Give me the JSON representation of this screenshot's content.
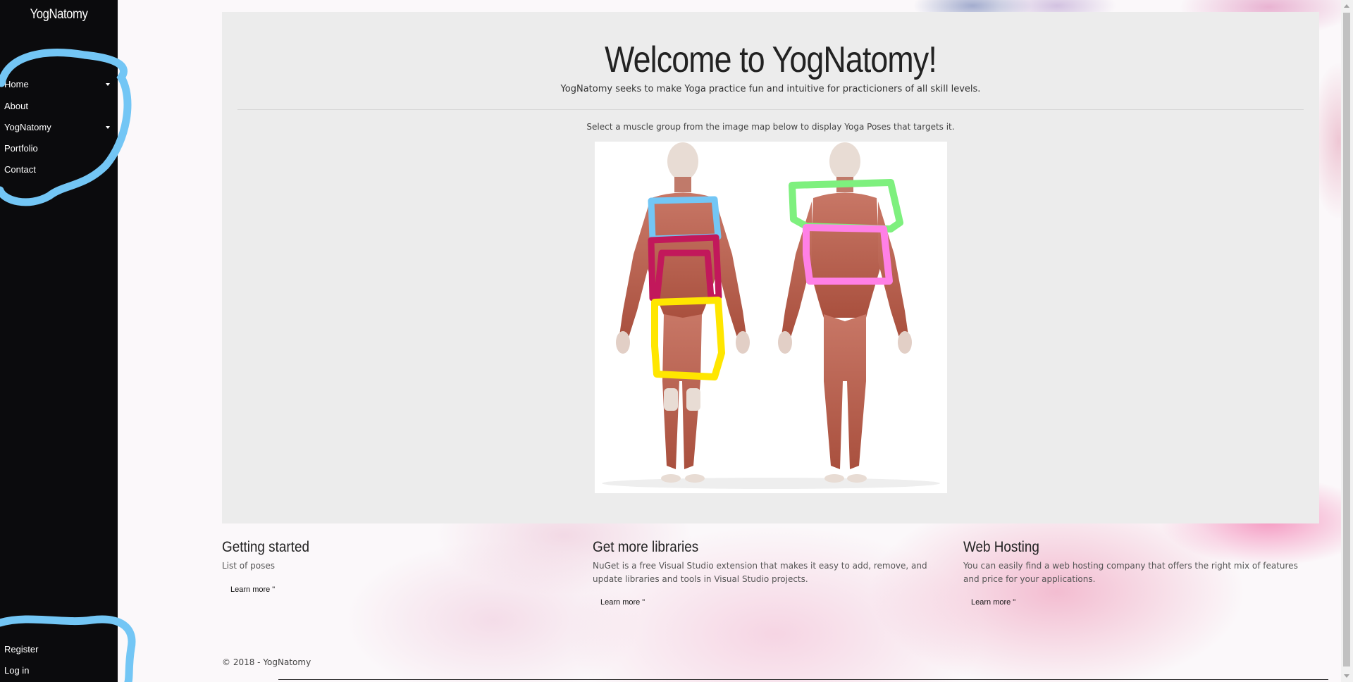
{
  "brand": "YogNatomy",
  "nav": {
    "items": [
      {
        "label": "Home",
        "has_caret": true
      },
      {
        "label": "About",
        "has_caret": false
      },
      {
        "label": "YogNatomy",
        "has_caret": true
      },
      {
        "label": "Portfolio",
        "has_caret": false
      },
      {
        "label": "Contact",
        "has_caret": false
      }
    ],
    "account": [
      {
        "label": "Register"
      },
      {
        "label": "Log in"
      }
    ]
  },
  "jumbotron": {
    "title": "Welcome to YogNatomy!",
    "subtitle": "YogNatomy seeks to make Yoga practice fun and intuitive for practicioners of all skill levels.",
    "instruction": "Select a muscle group from the image map below to display Yoga Poses that targets it."
  },
  "image_map": {
    "regions": [
      {
        "name": "chest",
        "color": "#73c6f5"
      },
      {
        "name": "abdomen",
        "color": "#c2185b"
      },
      {
        "name": "thighs",
        "color": "#ffe600"
      },
      {
        "name": "upper-back",
        "color": "#7ef07e"
      },
      {
        "name": "lower-back",
        "color": "#ff80e6"
      }
    ]
  },
  "annotations": {
    "color": "#73c6f5"
  },
  "columns": [
    {
      "title": "Getting started",
      "text": "List of poses",
      "button": "Learn more \""
    },
    {
      "title": "Get more libraries",
      "text": "NuGet is a free Visual Studio extension that makes it easy to add, remove, and update libraries and tools in Visual Studio projects.",
      "button": "Learn more \""
    },
    {
      "title": "Web Hosting",
      "text": "You can easily find a web hosting company that offers the right mix of features and price for your applications.",
      "button": "Learn more \""
    }
  ],
  "footer": "© 2018 - YogNatomy"
}
